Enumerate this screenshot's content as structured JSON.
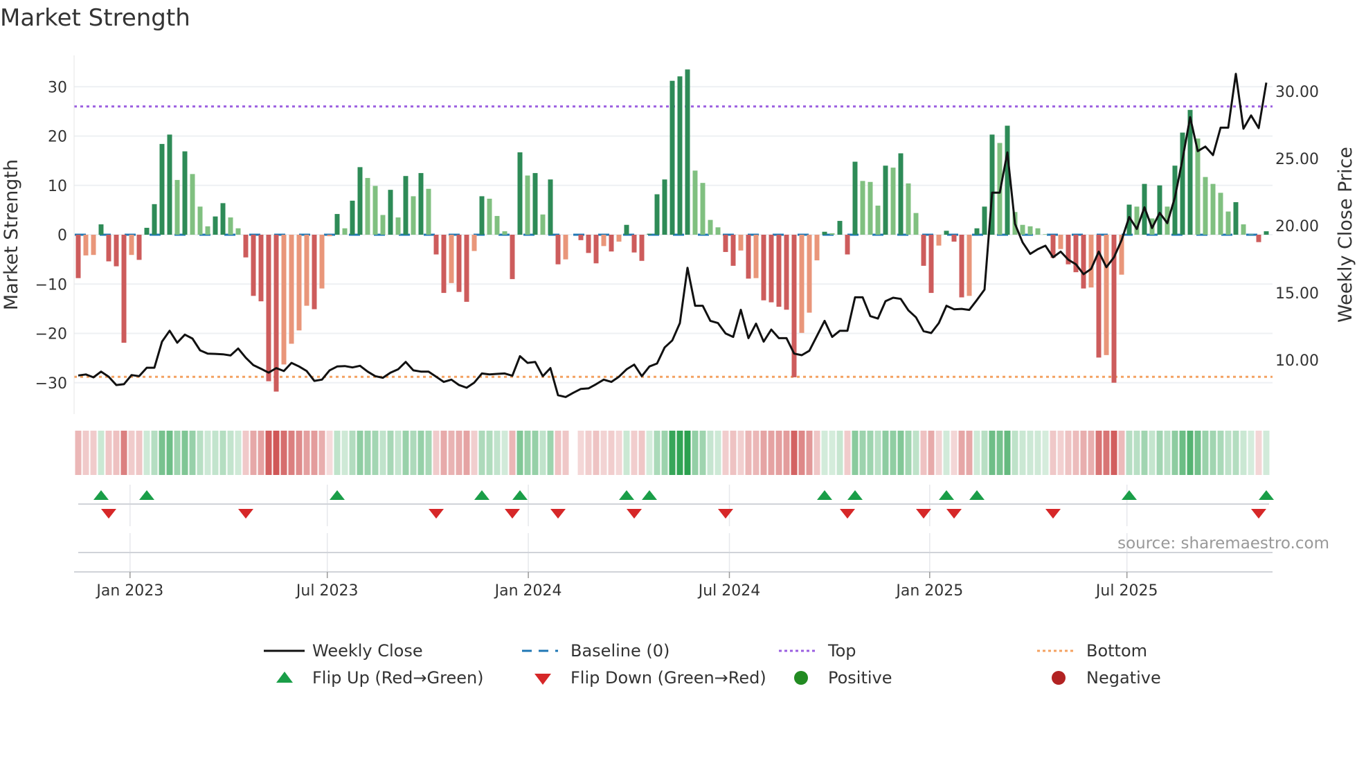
{
  "chart_data": {
    "type": "bar",
    "title": "Market Strength",
    "ylabel": "Market Strength",
    "y2label": "Weekly Close Price",
    "ylim": [
      -36,
      36
    ],
    "y_ticks": [
      30,
      20,
      10,
      0,
      -10,
      -20,
      -30
    ],
    "y_tick_labels": [
      "30",
      "20",
      "10",
      "0",
      "−10",
      "−20",
      "−30"
    ],
    "y2_ticks": [
      10,
      15,
      20,
      25,
      30
    ],
    "y2_tick_labels": [
      "10.00",
      "15.00",
      "20.00",
      "25.00",
      "30.00"
    ],
    "x_ticks": [
      {
        "label": "Jan 2023",
        "week": 6.8
      },
      {
        "label": "Jul 2023",
        "week": 32.7
      },
      {
        "label": "Jan 2024",
        "week": 59.1
      },
      {
        "label": "Jul 2024",
        "week": 85.5
      },
      {
        "label": "Jan 2025",
        "week": 111.8
      },
      {
        "label": "Jul 2025",
        "week": 137.7
      }
    ],
    "top_level": 26,
    "bottom_level": -28.8,
    "baseline": 0,
    "strength": [
      -8.8,
      -4.2,
      -4.1,
      2.1,
      -5.4,
      -6.4,
      -21.9,
      -4.1,
      -5.1,
      1.4,
      6.2,
      18.4,
      20.3,
      11.1,
      16.9,
      12.3,
      5.7,
      1.7,
      3.7,
      6.4,
      3.5,
      1.3,
      -4.6,
      -12.4,
      -13.5,
      -29.7,
      -31.8,
      -26.3,
      -22.1,
      -19.4,
      -14.4,
      -15.1,
      -10.9,
      -0.3,
      4.2,
      1.3,
      6.9,
      13.7,
      11.5,
      9.9,
      4.0,
      9.1,
      3.5,
      11.9,
      7.8,
      12.5,
      9.3,
      -4.0,
      -11.8,
      -9.8,
      -11.6,
      -13.6,
      -3.3,
      7.8,
      7.3,
      3.8,
      0.7,
      -9.0,
      16.7,
      12.0,
      12.5,
      4.1,
      11.2,
      -6.0,
      -5.0,
      0,
      -1.1,
      -3.7,
      -5.8,
      -2.3,
      -3.4,
      -1.4,
      2.0,
      -3.6,
      -5.3,
      0.2,
      8.2,
      11.2,
      31.2,
      32.1,
      33.5,
      13.0,
      10.5,
      3.0,
      1.5,
      -3.5,
      -6.3,
      -3.2,
      -8.9,
      -8.8,
      -13.3,
      -13.7,
      -14.6,
      -15.2,
      -28.9,
      -19.9,
      -15.8,
      -5.2,
      0.6,
      0.3,
      2.8,
      -4.0,
      14.8,
      10.9,
      10.7,
      5.9,
      14.0,
      13.6,
      16.5,
      10.4,
      4.4,
      -6.3,
      -11.8,
      -2.2,
      0.8,
      -1.4,
      -12.7,
      -12.4,
      1.3,
      5.7,
      20.3,
      18.6,
      22.1,
      4.6,
      2.0,
      1.7,
      1.3,
      0.1,
      -4.7,
      -2.9,
      -6.0,
      -7.6,
      -10.9,
      -10.7,
      -24.9,
      -24.4,
      -30.0,
      -8.1,
      6.1,
      5.7,
      10.3,
      3.3,
      10.0,
      5.7,
      14.0,
      20.7,
      25.3,
      19.5,
      11.7,
      10.3,
      8.5,
      4.7,
      6.6,
      2.1,
      0.1,
      -1.5,
      0.7
    ],
    "weekly_close": [
      8.85,
      8.93,
      8.71,
      9.14,
      8.76,
      8.14,
      8.2,
      8.88,
      8.8,
      9.43,
      9.43,
      11.37,
      12.18,
      11.29,
      11.89,
      11.6,
      10.72,
      10.48,
      10.46,
      10.43,
      10.34,
      10.86,
      10.17,
      9.62,
      9.35,
      9.06,
      9.4,
      9.18,
      9.79,
      9.52,
      9.18,
      8.45,
      8.54,
      9.23,
      9.52,
      9.55,
      9.45,
      9.57,
      9.14,
      8.8,
      8.68,
      9.06,
      9.31,
      9.86,
      9.23,
      9.14,
      9.14,
      8.76,
      8.37,
      8.54,
      8.14,
      7.94,
      8.32,
      9.0,
      8.93,
      8.97,
      9.0,
      8.83,
      10.29,
      9.79,
      9.86,
      8.8,
      9.4,
      7.38,
      7.25,
      7.56,
      7.85,
      7.89,
      8.2,
      8.54,
      8.37,
      8.76,
      9.31,
      9.66,
      8.8,
      9.52,
      9.74,
      10.94,
      11.46,
      12.75,
      16.87,
      14.04,
      14.04,
      12.92,
      12.75,
      11.98,
      11.72,
      13.74,
      11.63,
      12.71,
      11.37,
      12.27,
      11.63,
      11.63,
      10.48,
      10.36,
      10.69,
      11.8,
      12.92,
      11.72,
      12.18,
      12.18,
      14.67,
      14.67,
      13.27,
      13.09,
      14.38,
      14.64,
      14.55,
      13.7,
      13.18,
      12.15,
      12.01,
      12.75,
      14.04,
      13.78,
      13.81,
      13.73,
      14.47,
      15.24,
      22.46,
      22.46,
      25.46,
      20.14,
      18.76,
      17.9,
      18.25,
      18.51,
      17.65,
      18.07,
      17.47,
      17.13,
      16.39,
      16.79,
      18.07,
      16.91,
      17.65,
      18.93,
      20.65,
      19.76,
      21.37,
      19.83,
      20.96,
      20.19,
      22.11,
      24.95,
      28.08,
      25.55,
      25.89,
      25.26,
      27.3,
      27.3,
      31.31,
      27.22,
      28.21,
      27.27,
      30.65
    ],
    "flip_up_weeks": [
      3,
      9,
      34,
      53,
      58,
      72,
      75,
      98,
      102,
      114,
      118,
      138,
      156
    ],
    "flip_down_weeks": [
      4,
      22,
      47,
      57,
      63,
      73,
      85,
      101,
      111,
      115,
      128,
      155
    ],
    "legend": {
      "placement": "bottom",
      "items": [
        "Weekly Close",
        "Baseline (0)",
        "Top",
        "Bottom",
        "Flip Up (Red→Green)",
        "Flip Down (Green→Red)",
        "Positive",
        "Negative"
      ]
    },
    "source": "source: sharemaestro.com"
  },
  "colors": {
    "strong_green": "#2e8b57",
    "weak_green": "#80c080",
    "strong_red": "#cd5c5c",
    "weak_red": "#e9967a",
    "line": "#111111",
    "baseline": "#1f77b4",
    "top": "#9b5fe0",
    "bottom": "#f4a261",
    "flip_up": "#1a9e48",
    "flip_down": "#d62728",
    "positive": "#228b22",
    "negative": "#b22222"
  }
}
